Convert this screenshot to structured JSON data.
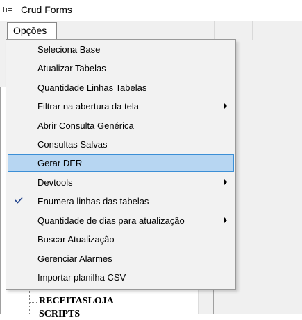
{
  "window": {
    "title": "Crud Forms",
    "icon": "app-icon"
  },
  "menubar": {
    "opcoes_label": "Opções"
  },
  "dropdown": {
    "items": [
      {
        "label": "Seleciona Base",
        "submenu": false,
        "checked": false,
        "highlighted": false
      },
      {
        "label": "Atualizar Tabelas",
        "submenu": false,
        "checked": false,
        "highlighted": false
      },
      {
        "label": "Quantidade Linhas Tabelas",
        "submenu": false,
        "checked": false,
        "highlighted": false
      },
      {
        "label": "Filtrar na abertura da tela",
        "submenu": true,
        "checked": false,
        "highlighted": false
      },
      {
        "label": "Abrir Consulta Genérica",
        "submenu": false,
        "checked": false,
        "highlighted": false
      },
      {
        "label": "Consultas Salvas",
        "submenu": false,
        "checked": false,
        "highlighted": false
      },
      {
        "label": "Gerar DER",
        "submenu": false,
        "checked": false,
        "highlighted": true
      },
      {
        "label": "Devtools",
        "submenu": true,
        "checked": false,
        "highlighted": false
      },
      {
        "label": "Enumera linhas das tabelas",
        "submenu": false,
        "checked": true,
        "highlighted": false
      },
      {
        "label": "Quantidade de dias para atualização",
        "submenu": true,
        "checked": false,
        "highlighted": false
      },
      {
        "label": "Buscar Atualização",
        "submenu": false,
        "checked": false,
        "highlighted": false
      },
      {
        "label": "Gerenciar Alarmes",
        "submenu": false,
        "checked": false,
        "highlighted": false
      },
      {
        "label": "Importar planilha CSV",
        "submenu": false,
        "checked": false,
        "highlighted": false
      }
    ]
  },
  "background_tree": {
    "items": [
      "RECEITASLOJA",
      "SCRIPTS"
    ]
  },
  "colors": {
    "highlight_bg": "#b7d6f2",
    "highlight_border": "#3c8fd6",
    "menu_bg": "#f2f2f2"
  }
}
